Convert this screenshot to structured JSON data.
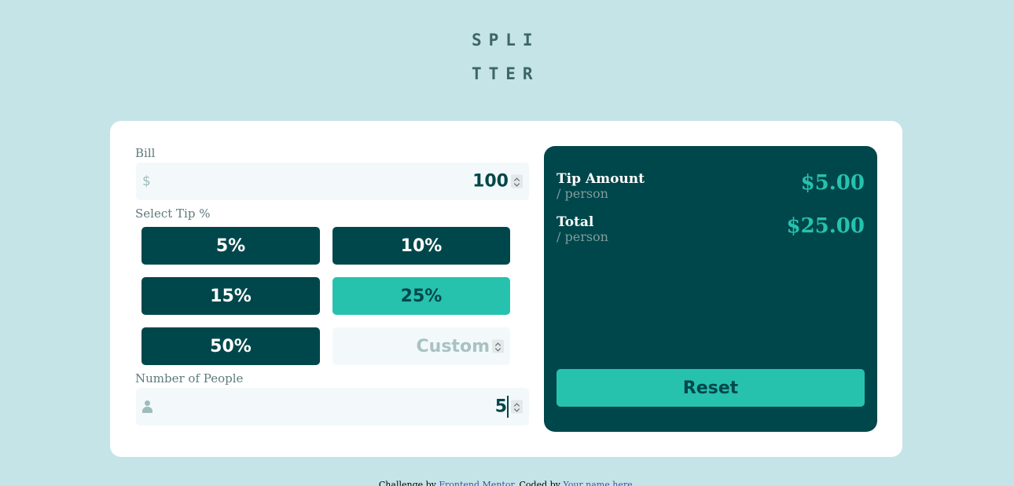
{
  "logo": {
    "line1": "SPLI",
    "line2": "TTER"
  },
  "bill": {
    "label": "Bill",
    "currency_symbol": "$",
    "value": "100"
  },
  "tip": {
    "label": "Select Tip %",
    "options": [
      "5%",
      "10%",
      "15%",
      "25%",
      "50%"
    ],
    "selected": "25%",
    "custom_placeholder": "Custom"
  },
  "people": {
    "label": "Number of People",
    "value": "5"
  },
  "results": {
    "tip_label": "Tip Amount",
    "tip_sub": "/ person",
    "tip_amount": "$5.00",
    "total_label": "Total",
    "total_sub": "/ person",
    "total_amount": "$25.00",
    "reset_label": "Reset"
  },
  "footer": {
    "prefix": "Challenge by",
    "challenge_link": "Frontend Mentor",
    "middle": ". Coded by",
    "author_link": "Your name here",
    "suffix": "."
  },
  "colors": {
    "background": "#c5e4e7",
    "dark_teal": "#00474b",
    "accent": "#26c2ae",
    "input_bg": "#f3f9fa",
    "muted_text": "#5e7a7d"
  }
}
